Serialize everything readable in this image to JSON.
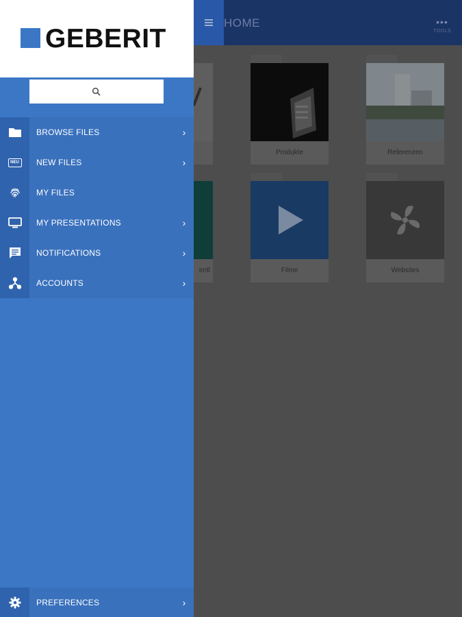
{
  "app": {
    "title": "HOME",
    "tools_label": "TOOLS"
  },
  "tiles": [
    {
      "caption": "Produkte"
    },
    {
      "caption": "Referenzen"
    },
    {
      "caption": "Filme"
    },
    {
      "caption": "Websites"
    },
    {
      "caption": "entl"
    }
  ],
  "drawer": {
    "logo_text": "GEBERIT",
    "search": {
      "icon": "search-icon",
      "value": ""
    },
    "items": [
      {
        "label": "BROWSE FILES",
        "icon": "folder-icon",
        "has_chevron": true
      },
      {
        "label": "NEW FILES",
        "icon": "new-badge-icon",
        "badge": "NEU",
        "has_chevron": true
      },
      {
        "label": "MY FILES",
        "icon": "fingerprint-icon",
        "has_chevron": false
      },
      {
        "label": "MY PRESENTATIONS",
        "icon": "monitor-icon",
        "has_chevron": true
      },
      {
        "label": "NOTIFICATIONS",
        "icon": "chat-bubble-icon",
        "has_chevron": true
      },
      {
        "label": "ACCOUNTS",
        "icon": "network-icon",
        "has_chevron": true
      }
    ],
    "footer": {
      "label": "PREFERENCES",
      "icon": "gear-icon",
      "has_chevron": true
    }
  },
  "colors": {
    "brand_blue": "#3c77c6",
    "header_navy": "#1b3466",
    "background_dim": "#4d4d4d"
  }
}
